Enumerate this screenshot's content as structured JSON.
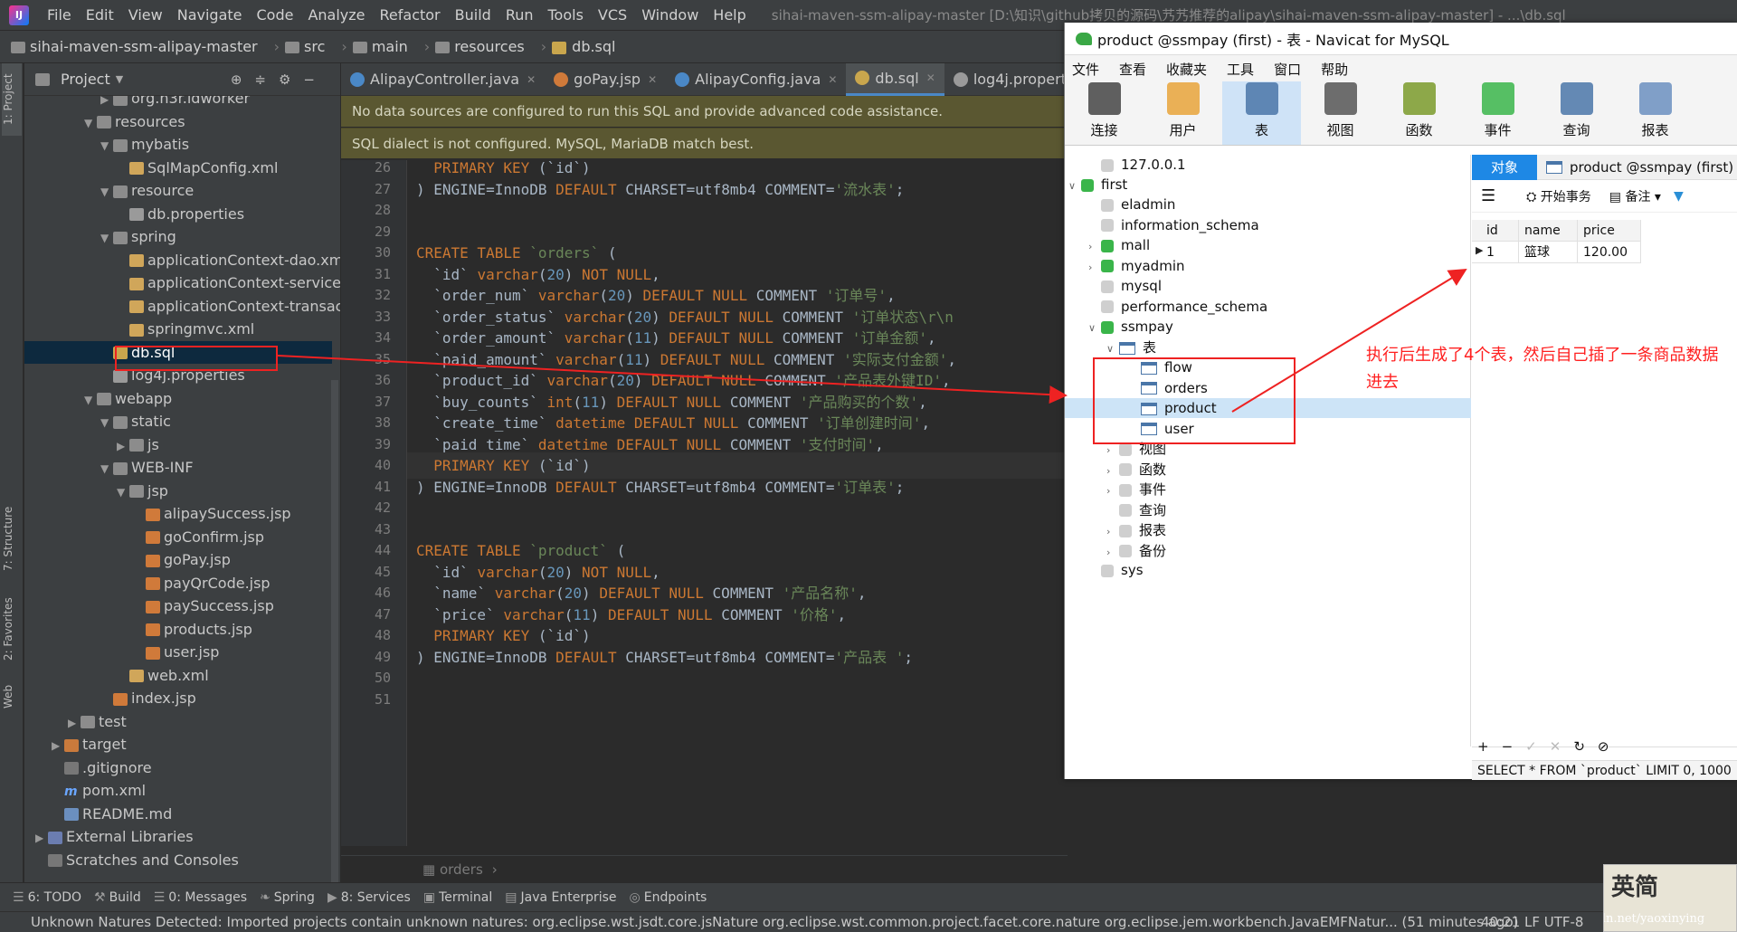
{
  "menubar": {
    "items": [
      "File",
      "Edit",
      "View",
      "Navigate",
      "Code",
      "Analyze",
      "Refactor",
      "Build",
      "Run",
      "Tools",
      "VCS",
      "Window",
      "Help"
    ],
    "window_title": "sihai-maven-ssm-alipay-master [D:\\知识\\github拷贝的源码\\艿艿推荐的alipay\\sihai-maven-ssm-alipay-master] - ...\\db.sql"
  },
  "breadcrumb": [
    "sihai-maven-ssm-alipay-master",
    "src",
    "main",
    "resources",
    "db.sql"
  ],
  "left_strip": {
    "project": "1: Project",
    "structure": "7: Structure",
    "favorites": "2: Favorites",
    "web": "Web"
  },
  "project_panel": {
    "title": "Project",
    "tree": [
      {
        "label": "org.n3r.idworker",
        "icon": "fd"
      },
      {
        "label": "resources",
        "icon": "fd"
      },
      {
        "label": "mybatis",
        "icon": "fd"
      },
      {
        "label": "SqlMapConfig.xml",
        "icon": "xml"
      },
      {
        "label": "resource",
        "icon": "fd"
      },
      {
        "label": "db.properties",
        "icon": "prop"
      },
      {
        "label": "spring",
        "icon": "fd"
      },
      {
        "label": "applicationContext-dao.xml",
        "icon": "xml"
      },
      {
        "label": "applicationContext-service.xml",
        "icon": "xml"
      },
      {
        "label": "applicationContext-transaction.xml",
        "icon": "xml"
      },
      {
        "label": "springmvc.xml",
        "icon": "xml"
      },
      {
        "label": "db.sql",
        "icon": "sql"
      },
      {
        "label": "log4j.properties",
        "icon": "prop"
      },
      {
        "label": "webapp",
        "icon": "fd"
      },
      {
        "label": "static",
        "icon": "fd"
      },
      {
        "label": "js",
        "icon": "fd"
      },
      {
        "label": "WEB-INF",
        "icon": "fd"
      },
      {
        "label": "jsp",
        "icon": "fd"
      },
      {
        "label": "alipaySuccess.jsp",
        "icon": "jsp"
      },
      {
        "label": "goConfirm.jsp",
        "icon": "jsp"
      },
      {
        "label": "goPay.jsp",
        "icon": "jsp"
      },
      {
        "label": "payQrCode.jsp",
        "icon": "jsp"
      },
      {
        "label": "paySuccess.jsp",
        "icon": "jsp"
      },
      {
        "label": "products.jsp",
        "icon": "jsp"
      },
      {
        "label": "user.jsp",
        "icon": "jsp"
      },
      {
        "label": "web.xml",
        "icon": "xml"
      },
      {
        "label": "index.jsp",
        "icon": "jsp"
      },
      {
        "label": "test",
        "icon": "fd"
      },
      {
        "label": "target",
        "icon": "fo"
      },
      {
        "label": ".gitignore",
        "icon": "git"
      },
      {
        "label": "pom.xml",
        "icon": "pom"
      },
      {
        "label": "README.md",
        "icon": "md"
      },
      {
        "label": "External Libraries",
        "icon": "lib"
      },
      {
        "label": "Scratches and Consoles",
        "icon": "git"
      }
    ]
  },
  "editor_tabs": [
    {
      "label": "AlipayController.java",
      "color": "#4a88c7",
      "active": false
    },
    {
      "label": "goPay.jsp",
      "color": "#d07a3a",
      "active": false
    },
    {
      "label": "AlipayConfig.java",
      "color": "#4a88c7",
      "active": false
    },
    {
      "label": "db.sql",
      "color": "#c9a64d",
      "active": true
    },
    {
      "label": "log4j.properties",
      "color": "#9a9a9a",
      "active": false
    }
  ],
  "banners": {
    "datasource": "No data sources are configured to run this SQL and provide advanced code assistance.",
    "dialect": "SQL dialect is not configured. MySQL, MariaDB match best."
  },
  "code_lines": [
    {
      "n": "26",
      "html": "  <span class='kw'>PRIMARY KEY</span> (<span class='bq'>`id`</span>)"
    },
    {
      "n": "27",
      "html": ") <span class='id'>ENGINE</span>=<span class='id'>InnoDB</span> <span class='kw'>DEFAULT</span> <span class='id'>CHARSET</span>=<span class='id'>utf8mb4</span> <span class='id'>COMMENT</span>=<span class='str'>'流水表'</span>;"
    },
    {
      "n": "28",
      "html": ""
    },
    {
      "n": "29",
      "html": ""
    },
    {
      "n": "30",
      "html": "<span class='kw'>CREATE TABLE</span> <span class='str'>`orders`</span> ("
    },
    {
      "n": "31",
      "html": "  <span class='bq'>`id`</span> <span class='kw'>varchar</span>(<span class='num'>20</span>) <span class='kw'>NOT NULL</span>,"
    },
    {
      "n": "32",
      "html": "  <span class='bq'>`order_num`</span> <span class='kw'>varchar</span>(<span class='num'>20</span>) <span class='kw'>DEFAULT NULL</span> <span class='id'>COMMENT</span> <span class='str'>'订单号'</span>,"
    },
    {
      "n": "33",
      "html": "  <span class='bq'>`order_status`</span> <span class='kw'>varchar</span>(<span class='num'>20</span>) <span class='kw'>DEFAULT NULL</span> <span class='id'>COMMENT</span> <span class='str'>'订单状态\\r\\n</span>"
    },
    {
      "n": "34",
      "html": "  <span class='bq'>`order_amount`</span> <span class='kw'>varchar</span>(<span class='num'>11</span>) <span class='kw'>DEFAULT NULL</span> <span class='id'>COMMENT</span> <span class='str'>'订单金额'</span>,"
    },
    {
      "n": "35",
      "html": "  <span class='bq'>`paid_amount`</span> <span class='kw'>varchar</span>(<span class='num'>11</span>) <span class='kw'>DEFAULT NULL</span> <span class='id'>COMMENT</span> <span class='str'>'实际支付金额'</span>,"
    },
    {
      "n": "36",
      "html": "  <span class='bq'>`product_id`</span> <span class='kw'>varchar</span>(<span class='num'>20</span>) <span class='kw'>DEFAULT NULL</span> <span class='id'>COMMENT</span> <span class='str'>'产品表外键ID'</span>,"
    },
    {
      "n": "37",
      "html": "  <span class='bq'>`buy_counts`</span> <span class='kw'>int</span>(<span class='num'>11</span>) <span class='kw'>DEFAULT NULL</span> <span class='id'>COMMENT</span> <span class='str'>'产品购买的个数'</span>,"
    },
    {
      "n": "38",
      "html": "  <span class='bq'>`create_time`</span> <span class='kw'>datetime</span> <span class='kw'>DEFAULT NULL</span> <span class='id'>COMMENT</span> <span class='str'>'订单创建时间'</span>,"
    },
    {
      "n": "39",
      "html": "  <span class='bq'>`paid_time`</span> <span class='kw'>datetime</span> <span class='kw'>DEFAULT NULL</span> <span class='id'>COMMENT</span> <span class='str'>'支付时间'</span>,"
    },
    {
      "n": "40",
      "html": "  <span class='kw'>PRIMARY KEY</span> (<span class='bq'>`id`</span>)"
    },
    {
      "n": "41",
      "html": ") <span class='id'>ENGINE</span>=<span class='id'>InnoDB</span> <span class='kw'>DEFAULT</span> <span class='id'>CHARSET</span>=<span class='id'>utf8mb4</span> <span class='id'>COMMENT</span>=<span class='str'>'订单表'</span>;"
    },
    {
      "n": "42",
      "html": ""
    },
    {
      "n": "43",
      "html": ""
    },
    {
      "n": "44",
      "html": "<span class='kw'>CREATE TABLE</span> <span class='str'>`product`</span> ("
    },
    {
      "n": "45",
      "html": "  <span class='bq'>`id`</span> <span class='kw'>varchar</span>(<span class='num'>20</span>) <span class='kw'>NOT NULL</span>,"
    },
    {
      "n": "46",
      "html": "  <span class='bq'>`name`</span> <span class='kw'>varchar</span>(<span class='num'>20</span>) <span class='kw'>DEFAULT NULL</span> <span class='id'>COMMENT</span> <span class='str'>'产品名称'</span>,"
    },
    {
      "n": "47",
      "html": "  <span class='bq'>`price`</span> <span class='kw'>varchar</span>(<span class='num'>11</span>) <span class='kw'>DEFAULT NULL</span> <span class='id'>COMMENT</span> <span class='str'>'价格'</span>,"
    },
    {
      "n": "48",
      "html": "  <span class='kw'>PRIMARY KEY</span> (<span class='bq'>`id`</span>)"
    },
    {
      "n": "49",
      "html": ") <span class='id'>ENGINE</span>=<span class='id'>InnoDB</span> <span class='kw'>DEFAULT</span> <span class='id'>CHARSET</span>=<span class='id'>utf8mb4</span> <span class='id'>COMMENT</span>=<span class='str'>'产品表 '</span>;"
    },
    {
      "n": "50",
      "html": ""
    },
    {
      "n": "51",
      "html": ""
    }
  ],
  "editor_footer": "orders",
  "tool_windows": [
    {
      "label": "6: TODO",
      "glyph": "☰"
    },
    {
      "label": "Build",
      "glyph": "⚒"
    },
    {
      "label": "0: Messages",
      "glyph": "☰"
    },
    {
      "label": "Spring",
      "glyph": "❧"
    },
    {
      "label": "8: Services",
      "glyph": "▶"
    },
    {
      "label": "Terminal",
      "glyph": "▣"
    },
    {
      "label": "Java Enterprise",
      "glyph": "▤"
    },
    {
      "label": "Endpoints",
      "glyph": "◎"
    }
  ],
  "status_text": "Unknown Natures Detected: Imported projects contain unknown natures: org.eclipse.wst.jsdt.core.jsNature org.eclipse.wst.common.project.facet.core.nature org.eclipse.jem.workbench.JavaEMFNatur... (51 minutes ago)",
  "status_pos": "40:21  LF  UTF-8",
  "navicat": {
    "title": "product @ssmpay (first) - 表 - Navicat for MySQL",
    "menu": [
      "文件",
      "查看",
      "收藏夹",
      "工具",
      "窗口",
      "帮助"
    ],
    "toolbar": [
      {
        "label": "连接",
        "color": "#444444"
      },
      {
        "label": "用户",
        "color": "#e8a33a"
      },
      {
        "label": "表",
        "color": "#4a76a8"
      },
      {
        "label": "视图",
        "color": "#555555"
      },
      {
        "label": "函数",
        "color": "#7a9a2a"
      },
      {
        "label": "事件",
        "color": "#3ab54a"
      },
      {
        "label": "查询",
        "color": "#4a76a8"
      },
      {
        "label": "报表",
        "color": "#6b8fbf"
      }
    ],
    "tree": {
      "server": "127.0.0.1",
      "connection": "first",
      "dbs": [
        "eladmin",
        "information_schema",
        "mall",
        "myadmin",
        "mysql",
        "performance_schema",
        "ssmpay"
      ],
      "tables_label": "表",
      "tables": [
        "flow",
        "orders",
        "product",
        "user"
      ],
      "others": [
        "视图",
        "函数",
        "事件",
        "查询",
        "报表",
        "备份"
      ],
      "last_db": "sys"
    },
    "right": {
      "objects_tab": "对象",
      "product_tab": "product @ssmpay (first)",
      "begin_tx": "开始事务",
      "note": "备注",
      "columns": [
        "id",
        "name",
        "price"
      ],
      "row": [
        "1",
        "篮球",
        "120.00"
      ],
      "footer_buttons": [
        "+",
        "−",
        "✓",
        "✕",
        "↻",
        "⊘"
      ],
      "sql": "SELECT * FROM `product` LIMIT 0, 1000"
    }
  },
  "annotation": "执行后生成了4个表，然后自己插了一条商品数据进去",
  "watermark": {
    "chars": "英简",
    "url": "https://blog.csdn.net/yaoxinying"
  },
  "colors": {
    "accent_red": "#ee2222",
    "ide_bg": "#2b2b2b",
    "panel_bg": "#3c3f41",
    "navicat_blue": "#1e88e5"
  }
}
